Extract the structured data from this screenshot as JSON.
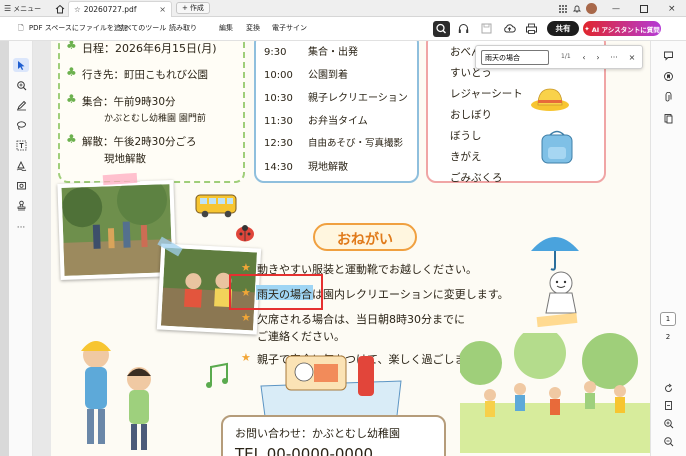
{
  "window": {
    "menu_label": "メニュー",
    "tab_title": "20260727.pdf",
    "new_tab_label": "作成"
  },
  "toolbar": {
    "add_files_label": "PDF スペースにファイルを追加",
    "menus": [
      "すべてのツール",
      "読み取り",
      "編集",
      "変換",
      "電子サイン"
    ],
    "share_label": "共有",
    "ai_label": "AI アシスタントに質問"
  },
  "find": {
    "query": "雨天の場合",
    "count": "1/1",
    "more_label": "···"
  },
  "pages": {
    "items": [
      "1",
      "2"
    ],
    "current": "1"
  },
  "document": {
    "info": [
      {
        "label": "日程",
        "value": "2026年6月15日(月)"
      },
      {
        "label": "行き先",
        "value": "町田こもれび公園"
      },
      {
        "label": "集合",
        "value": "午前9時30分",
        "value2": "かぶとむし幼稚園 園門前"
      },
      {
        "label": "解散",
        "value": "午後2時30分ごろ",
        "value2": "現地解散"
      }
    ],
    "schedule": [
      {
        "time": "9:30",
        "event": "集合・出発"
      },
      {
        "time": "10:00",
        "event": "公園到着"
      },
      {
        "time": "10:30",
        "event": "親子レクリエーション"
      },
      {
        "time": "11:30",
        "event": "お弁当タイム"
      },
      {
        "time": "12:30",
        "event": "自由あそび・写真撮影"
      },
      {
        "time": "14:30",
        "event": "現地解散"
      }
    ],
    "items": [
      "おべんとう",
      "すいとう",
      "レジャーシート",
      "おしぼり",
      "ぼうし",
      "きがえ",
      "ごみぶくろ"
    ],
    "notice_title": "おねがい",
    "notices": [
      "動きやすい服装と運動靴でお越しください。",
      "雨天の場合は園内レクリエーションに変更します。",
      "欠席される場合は、当日朝8時30分までに",
      "ご連絡ください。",
      "親子で安全に気をつけて、楽しく過ごしましょう。"
    ],
    "highlight": "雨天の場合",
    "contact": "お問い合わせ：かぶとむし幼稚園",
    "tel": "TEL 00-0000-0000"
  }
}
